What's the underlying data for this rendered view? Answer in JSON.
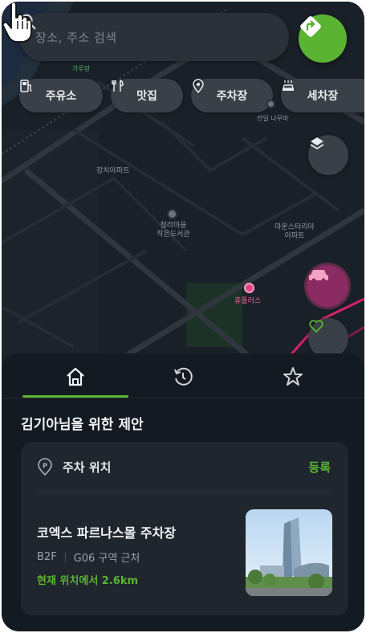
{
  "search": {
    "placeholder": "장소, 주소 검색"
  },
  "chips": [
    {
      "label": "주유소",
      "icon": "gas-station-icon"
    },
    {
      "label": "맛집",
      "icon": "fork-knife-icon"
    },
    {
      "label": "주차장",
      "icon": "pin-icon"
    },
    {
      "label": "세차장",
      "icon": "car-wash-icon"
    }
  ],
  "map_labels": {
    "building_1": "잔일\n나무마",
    "building_2": "장치아파트",
    "library": "청라마을\n작은도서관",
    "apartment": "마운스타리아\n아파트",
    "poi_pink": "휴플러스",
    "top_green": "가루장"
  },
  "tabs": [
    {
      "name": "home",
      "icon": "home-icon",
      "active": true
    },
    {
      "name": "recent",
      "icon": "history-icon",
      "active": false
    },
    {
      "name": "favorites",
      "icon": "star-icon",
      "active": false
    }
  ],
  "sheet": {
    "title": "김기아님을 위한 제안",
    "card": {
      "label": "주차 위치",
      "action": "등록",
      "lot_name": "코엑스 파르나스몰 주차장",
      "floor": "B2F",
      "zone": "G06 구역 근처",
      "distance": "현재 위치에서 2.6km"
    }
  },
  "colors": {
    "accent": "#5bb431",
    "parking_pink": "#e0467f",
    "sheet_bg": "#141a21",
    "card_bg": "#1f262d"
  }
}
